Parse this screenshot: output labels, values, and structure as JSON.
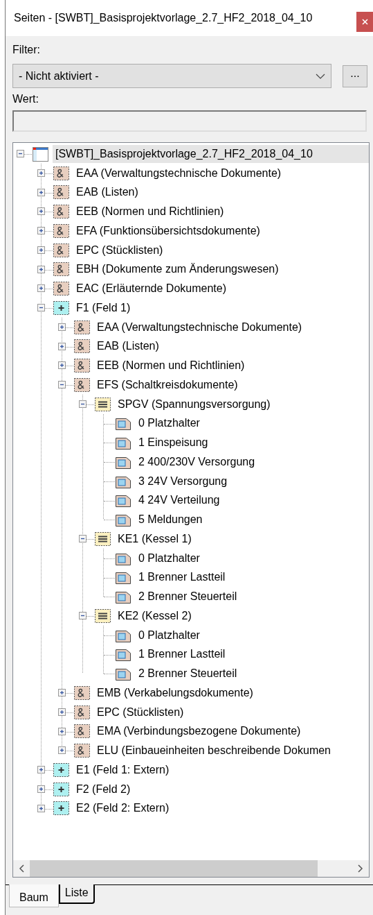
{
  "window": {
    "title": "Seiten - [SWBT]_Basisprojektvorlage_2.7_HF2_2018_04_10"
  },
  "filter": {
    "label": "Filter:",
    "value": "- Nicht aktiviert -",
    "more_button": "..."
  },
  "value_field": {
    "label": "Wert:",
    "disabled": true
  },
  "tree": [
    {
      "kind": "project",
      "label": "[SWBT]_Basisprojektvorlage_2.7_HF2_2018_04_10",
      "expanded": true,
      "selected": true,
      "children": [
        {
          "kind": "structure",
          "label": "EAA (Verwaltungstechnische Dokumente)",
          "expanded": false,
          "selected": false
        },
        {
          "kind": "structure",
          "label": "EAB (Listen)",
          "expanded": false,
          "selected": false
        },
        {
          "kind": "structure",
          "label": "EEB (Normen und Richtlinien)",
          "expanded": false,
          "selected": false
        },
        {
          "kind": "structure",
          "label": "EFA (Funktionsübersichtsdokumente)",
          "expanded": false,
          "selected": false
        },
        {
          "kind": "structure",
          "label": "EPC (Stücklisten)",
          "expanded": false,
          "selected": false
        },
        {
          "kind": "structure",
          "label": "EBH (Dokumente zum Änderungswesen)",
          "expanded": false,
          "selected": false
        },
        {
          "kind": "structure",
          "label": "EAC (Erläuternde Dokumente)",
          "expanded": false,
          "selected": false
        },
        {
          "kind": "field",
          "label": "F1 (Feld 1)",
          "expanded": true,
          "selected": false,
          "children": [
            {
              "kind": "structure",
              "label": "EAA (Verwaltungstechnische Dokumente)",
              "expanded": false,
              "selected": false
            },
            {
              "kind": "structure",
              "label": "EAB (Listen)",
              "expanded": false,
              "selected": false
            },
            {
              "kind": "structure",
              "label": "EEB (Normen und Richtlinien)",
              "expanded": false,
              "selected": false
            },
            {
              "kind": "structure",
              "label": "EFS (Schaltkreisdokumente)",
              "expanded": true,
              "selected": false,
              "children": [
                {
                  "kind": "group",
                  "label": "SPGV (Spannungsversorgung)",
                  "expanded": true,
                  "selected": false,
                  "children": [
                    {
                      "kind": "page",
                      "label": "0 Platzhalter",
                      "selected": false
                    },
                    {
                      "kind": "page",
                      "label": "1 Einspeisung",
                      "selected": false
                    },
                    {
                      "kind": "page",
                      "label": "2 400/230V Versorgung",
                      "selected": false
                    },
                    {
                      "kind": "page",
                      "label": "3 24V Versorgung",
                      "selected": false
                    },
                    {
                      "kind": "page",
                      "label": "4 24V Verteilung",
                      "selected": false
                    },
                    {
                      "kind": "page",
                      "label": "5 Meldungen",
                      "selected": false
                    }
                  ]
                },
                {
                  "kind": "group",
                  "label": "KE1 (Kessel 1)",
                  "expanded": true,
                  "selected": false,
                  "children": [
                    {
                      "kind": "page",
                      "label": "0 Platzhalter",
                      "selected": false
                    },
                    {
                      "kind": "page",
                      "label": "1 Brenner Lastteil",
                      "selected": false
                    },
                    {
                      "kind": "page",
                      "label": "2 Brenner Steuerteil",
                      "selected": false
                    }
                  ]
                },
                {
                  "kind": "group",
                  "label": "KE2 (Kessel 2)",
                  "expanded": true,
                  "selected": false,
                  "children": [
                    {
                      "kind": "page",
                      "label": "0 Platzhalter",
                      "selected": false
                    },
                    {
                      "kind": "page",
                      "label": "1 Brenner Lastteil",
                      "selected": false
                    },
                    {
                      "kind": "page",
                      "label": "2 Brenner Steuerteil",
                      "selected": false
                    }
                  ]
                }
              ]
            },
            {
              "kind": "structure",
              "label": "EMB (Verkabelungsdokumente)",
              "expanded": false,
              "selected": false
            },
            {
              "kind": "structure",
              "label": "EPC (Stücklisten)",
              "expanded": false,
              "selected": false
            },
            {
              "kind": "structure",
              "label": "EMA (Verbindungsbezogene Dokumente)",
              "expanded": false,
              "selected": false
            },
            {
              "kind": "structure",
              "label": "ELU (Einbaueinheiten beschreibende Dokumen",
              "expanded": false,
              "selected": false
            }
          ]
        },
        {
          "kind": "field",
          "label": "E1 (Feld 1: Extern)",
          "expanded": false,
          "selected": false
        },
        {
          "kind": "field",
          "label": "F2 (Feld 2)",
          "expanded": false,
          "selected": false
        },
        {
          "kind": "field",
          "label": "E2 (Feld 2: Extern)",
          "expanded": false,
          "selected": false
        }
      ]
    }
  ],
  "tabs": [
    {
      "label": "Baum",
      "selected": true
    },
    {
      "label": "Liste",
      "selected": false
    }
  ]
}
